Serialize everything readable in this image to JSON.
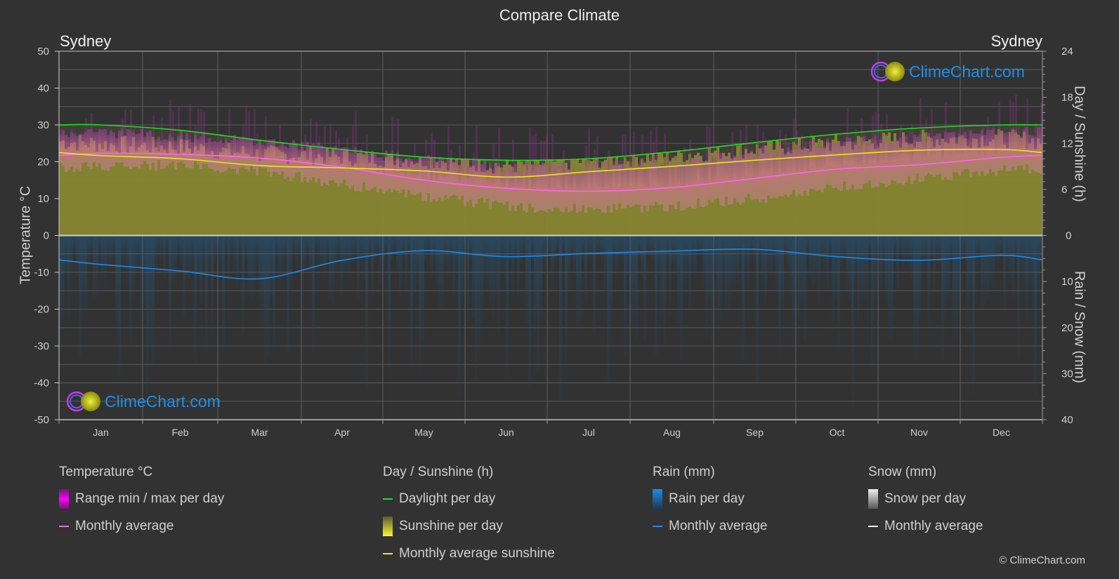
{
  "page": {
    "title": "Compare Climate",
    "city_left": "Sydney",
    "city_right": "Sydney",
    "copyright": "© ClimeChart.com",
    "logo_text": "ClimeChart.com"
  },
  "axes": {
    "left_title": "Temperature °C",
    "right_top_title": "Day / Sunshine (h)",
    "right_bottom_title": "Rain / Snow (mm)"
  },
  "legend": {
    "temperature": {
      "title": "Temperature °C",
      "items": [
        {
          "label": "Range min / max per day",
          "kind": "box",
          "color": "#e81ee8"
        },
        {
          "label": "Monthly average",
          "kind": "line",
          "color": "#ff66ee"
        }
      ]
    },
    "sunshine": {
      "title": "Day / Sunshine (h)",
      "items": [
        {
          "label": "Daylight per day",
          "kind": "line",
          "color": "#22dd22"
        },
        {
          "label": "Sunshine per day",
          "kind": "box",
          "color": "#e8e830"
        },
        {
          "label": "Monthly average sunshine",
          "kind": "line",
          "color": "#e8e820"
        }
      ]
    },
    "rain": {
      "title": "Rain (mm)",
      "items": [
        {
          "label": "Rain per day",
          "kind": "box",
          "color": "#1e8ae8"
        },
        {
          "label": "Monthly average",
          "kind": "line",
          "color": "#1e8ae8"
        }
      ]
    },
    "snow": {
      "title": "Snow (mm)",
      "items": [
        {
          "label": "Snow per day",
          "kind": "box",
          "color": "#dddddd"
        },
        {
          "label": "Monthly average",
          "kind": "line",
          "color": "#eeeeee"
        }
      ]
    }
  },
  "chart_data": {
    "type": "line",
    "title": "Compare Climate",
    "categories": [
      "Jan",
      "Feb",
      "Mar",
      "Apr",
      "May",
      "Jun",
      "Jul",
      "Aug",
      "Sep",
      "Oct",
      "Nov",
      "Dec"
    ],
    "left_axis": {
      "label": "Temperature °C",
      "range": [
        -50,
        50
      ],
      "ticks": [
        50,
        40,
        30,
        20,
        10,
        0,
        -10,
        -20,
        -30,
        -40,
        -50
      ]
    },
    "right_axis_top": {
      "label": "Day / Sunshine (h)",
      "range": [
        0,
        24
      ],
      "ticks": [
        24,
        18,
        12,
        6,
        0
      ]
    },
    "right_axis_bottom": {
      "label": "Rain / Snow (mm)",
      "range": [
        0,
        40
      ],
      "ticks": [
        0,
        10,
        20,
        30,
        40
      ]
    },
    "grid": true,
    "series": [
      {
        "name": "Temperature monthly average (°C)",
        "axis": "left",
        "color": "#ff66ee",
        "values": [
          22.3,
          22.0,
          21.0,
          18.5,
          15.0,
          12.8,
          12.0,
          13.0,
          15.5,
          18.0,
          19.2,
          21.2
        ]
      },
      {
        "name": "Daylight per day (h)",
        "axis": "right_top",
        "color": "#22dd22",
        "values": [
          14.4,
          13.7,
          12.4,
          11.2,
          10.2,
          9.8,
          10.0,
          10.9,
          12.1,
          13.2,
          14.0,
          14.4
        ]
      },
      {
        "name": "Monthly average sunshine (h)",
        "axis": "right_top",
        "color": "#e8e820",
        "values": [
          10.4,
          10.0,
          9.1,
          8.8,
          8.4,
          7.6,
          8.3,
          9.0,
          9.8,
          10.5,
          11.1,
          11.2
        ]
      },
      {
        "name": "Rain monthly average (mm)",
        "axis": "right_bottom",
        "color": "#1e8ae8",
        "values": [
          6.3,
          7.7,
          9.4,
          5.4,
          3.3,
          4.6,
          3.9,
          3.4,
          3.0,
          4.6,
          5.4,
          4.3
        ]
      }
    ],
    "temperature_range_band": {
      "name": "Range min / max per day (°C, approx monthly envelope)",
      "max": [
        27.5,
        26.5,
        25.0,
        22.5,
        20.0,
        18.0,
        18.0,
        19.0,
        22.0,
        24.5,
        26.0,
        27.5
      ],
      "min": [
        19.0,
        19.0,
        17.5,
        14.0,
        10.5,
        8.0,
        7.0,
        8.0,
        10.0,
        13.0,
        15.5,
        17.5
      ]
    },
    "legend_position": "bottom"
  }
}
